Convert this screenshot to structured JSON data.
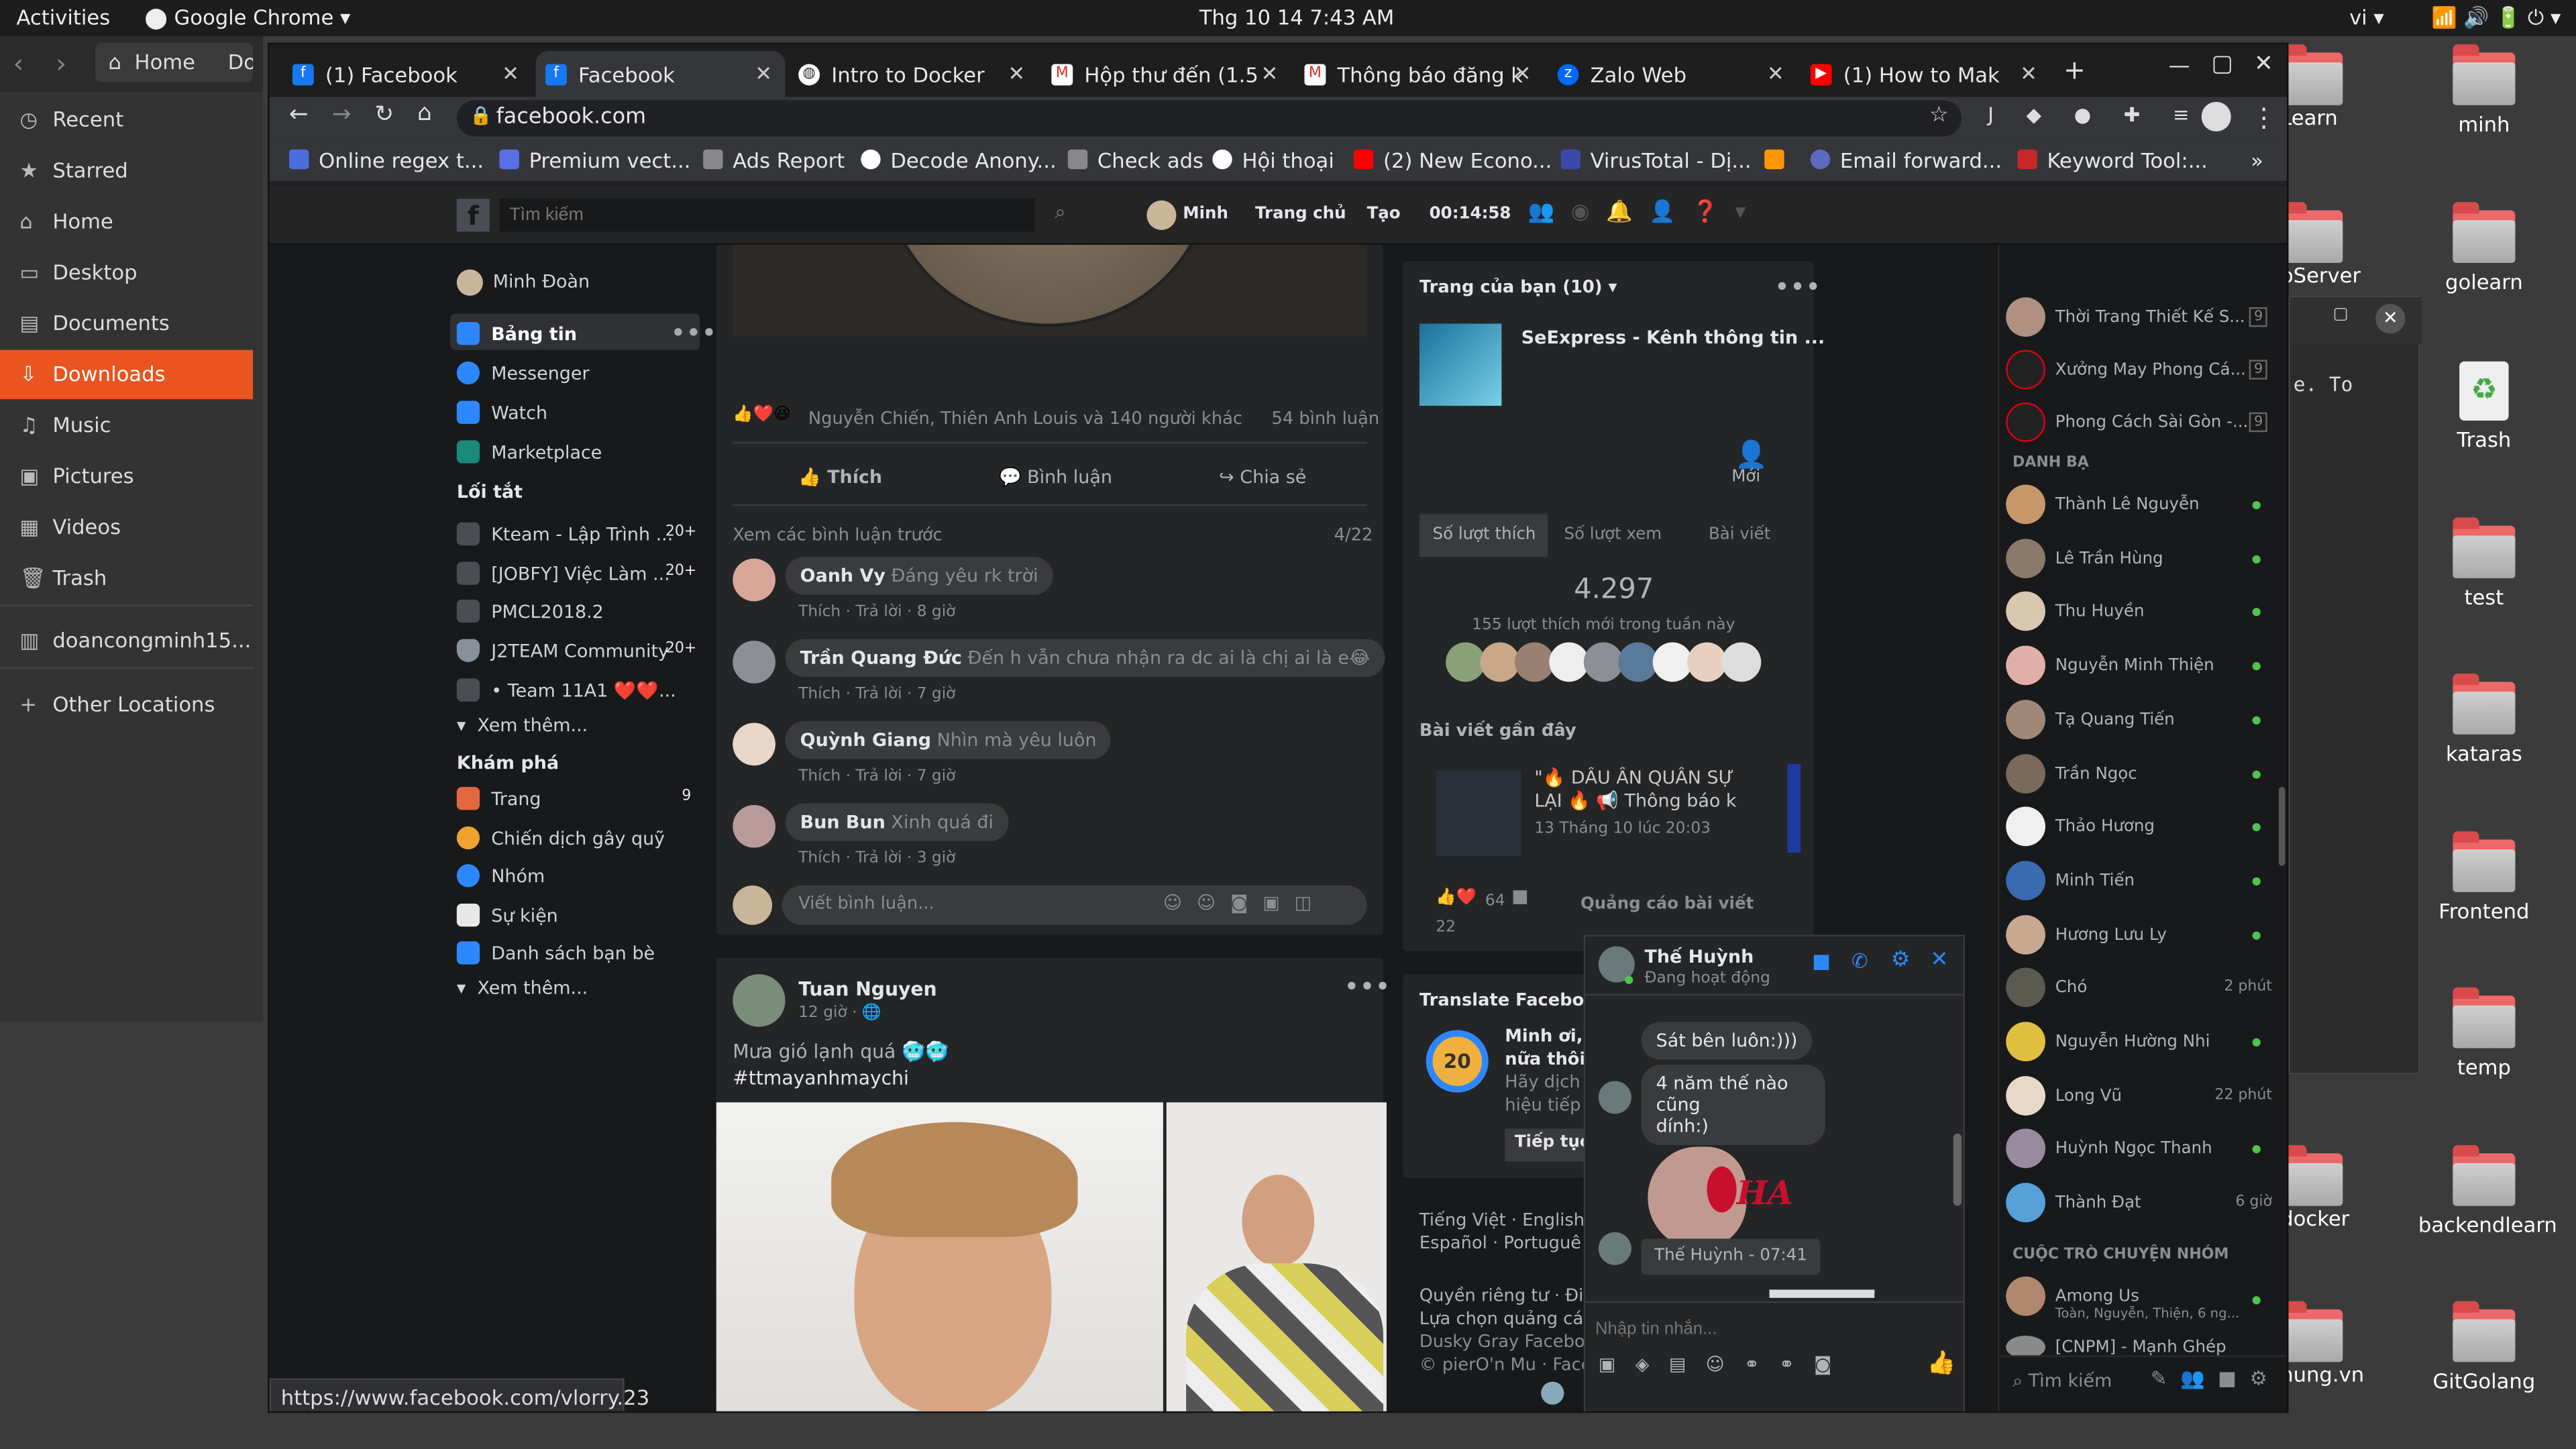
{
  "topbar": {
    "activities": "Activities",
    "app": "Google Chrome",
    "clock": "Thg 10 14   7:43 AM",
    "lang": "vi"
  },
  "desktop": {
    "icons": [
      "minh",
      "golearn",
      "Trash",
      "test",
      "kataras",
      "Frontend",
      "temp",
      "backendlearn",
      "GitGolang"
    ],
    "partial": [
      "Learn",
      "pServer",
      "docker",
      "hung.vn"
    ]
  },
  "files": {
    "home_label": "Home",
    "partial_tab": "Do",
    "sidebar": [
      "Recent",
      "Starred",
      "Home",
      "Desktop",
      "Documents",
      "Downloads",
      "Music",
      "Pictures",
      "Videos",
      "Trash",
      "doancongminh15...",
      "Other Locations"
    ]
  },
  "terminal_snippet": "e. To",
  "chrome": {
    "tabs": [
      "(1) Facebook",
      "Facebook",
      "Intro to Docker",
      "Hộp thư đến (1.5",
      "Thông báo đăng k",
      "Zalo Web",
      "(1) How to Mak"
    ],
    "url": "facebook.com",
    "bookmarks": [
      "Online regex t...",
      "Premium vect...",
      "Ads Report",
      "Decode Anony...",
      "Check ads",
      "Hội thoại",
      "(2) New Econo...",
      "VirusTotal - Dị...",
      "",
      "Email forward...",
      "Keyword Tool:..."
    ],
    "status_url": "https://www.facebook.com/vlorry.23"
  },
  "fb": {
    "search_placeholder": "Tìm kiếm",
    "header": {
      "user": "Minh",
      "home": "Trang chủ",
      "create": "Tạo",
      "timer": "00:14:58"
    },
    "left": {
      "user": "Minh Đoàn",
      "feed": "Bảng tin",
      "messenger": "Messenger",
      "watch": "Watch",
      "marketplace": "Marketplace",
      "shortcuts_title": "Lối tắt",
      "shortcuts": [
        {
          "label": "Kteam - Lập Trình ...",
          "badge": "20+"
        },
        {
          "label": "[JOBFY] Việc Làm ...",
          "badge": "20+"
        },
        {
          "label": "PMCL2018.2",
          "badge": ""
        },
        {
          "label": "J2TEAM Community",
          "badge": "20+"
        },
        {
          "label": "• Team 11A1 ❤️❤️...",
          "badge": ""
        }
      ],
      "see_more": "Xem thêm...",
      "explore_title": "Khám phá",
      "explore": [
        {
          "label": "Trang",
          "badge": "9"
        },
        {
          "label": "Chiến dịch gây quỹ",
          "badge": ""
        },
        {
          "label": "Nhóm",
          "badge": ""
        },
        {
          "label": "Sự kiện",
          "badge": ""
        },
        {
          "label": "Danh sách bạn bè",
          "badge": ""
        }
      ],
      "see_more2": "Xem thêm..."
    },
    "post1": {
      "reactions": "Nguyễn Chiến, Thiên Anh Louis và 140 người khác",
      "comments_count": "54 bình luận",
      "like": "Thích",
      "comment": "Bình luận",
      "share": "Chia sẻ",
      "prev_comments": "Xem các bình luận trước",
      "page": "4/22",
      "comments": [
        {
          "name": "Oanh Vy",
          "text": "Đáng yêu rk trời",
          "time": "8 giờ"
        },
        {
          "name": "Trần Quang Đức",
          "text": "Đến h vẫn chưa nhận ra dc ai là chị ai là e😂",
          "time": "7 giờ"
        },
        {
          "name": "Quỳnh Giang",
          "text": "Nhìn mà yêu luôn",
          "time": "7 giờ"
        },
        {
          "name": "Bun Bun",
          "text": "Xinh quá đi",
          "time": "3 giờ"
        }
      ],
      "meta_prefix": "Thích · Trả lời · ",
      "write_comment": "Viết bình luận..."
    },
    "post2": {
      "author": "Tuan Nguyen",
      "time": "12 giờ · 🌐",
      "text1": "Mưa gió lạnh quá 🥶🥶",
      "text2": "#ttmayanhmaychi"
    },
    "pages": {
      "title": "Trang của bạn (10) ▾",
      "page_name": "SeExpress - Kênh thông tin ...",
      "new_label": "Mới",
      "tabs": [
        "Số lượt thích",
        "Số lượt xem",
        "Bài viết"
      ],
      "likes": "4.297",
      "likes_sub": "155 lượt thích mới trong tuần này",
      "recent": "Bài viết gần đây",
      "recent_post": "\"🔥 DẤU ẤN QUÂN SỰ LẠI 🔥 📢 Thông báo k",
      "recent_date": "13 Tháng 10 lúc 20:03",
      "react_count": "64",
      "react_count2": "22",
      "promote": "Quảng cáo bài viết"
    },
    "translate": {
      "title": "Translate Facebook",
      "line1": "Minh ơi, l",
      "line2": "nữa thôi!",
      "line3": "Hãy dịch",
      "line4": "hiệu tiếp t",
      "button": "Tiếp tục",
      "badge": "20"
    },
    "footer": {
      "langs": "Tiếng Việt · English (",
      "langs2": "Español · Portuguê",
      "privacy": "Quyền riêng tư · Điều",
      "ads": "Lựa chọn quảng cáo",
      "dusky": "Dusky Gray Faceboo",
      "pier": "© pierO'n Mu · Faceb"
    },
    "chat": {
      "name": "Thế Huỳnh",
      "status": "Đang hoạt động",
      "messages": [
        "Sát bên luôn:)))",
        "4 năm thế nào cũng\ndính:)"
      ],
      "sticker_text": "HA",
      "stamp": "Thế Huỳnh - 07:41",
      "input_placeholder": "Nhập tin nhắn..."
    },
    "contacts": {
      "pages": [
        {
          "name": "Thời Trang Thiết Kế S...",
          "badge": "9"
        },
        {
          "name": "Xưởng May Phong Cá...",
          "badge": "9"
        },
        {
          "name": "Phong Cách Sài Gòn -...",
          "badge": "9"
        }
      ],
      "section": "DANH BẠ",
      "people": [
        {
          "name": "Thành Lê Nguyễn",
          "status": ""
        },
        {
          "name": "Lê Trần Hùng",
          "status": ""
        },
        {
          "name": "Thu Huyền",
          "status": ""
        },
        {
          "name": "Nguyễn Minh Thiện",
          "status": ""
        },
        {
          "name": "Tạ Quang Tiến",
          "status": ""
        },
        {
          "name": "Trần Ngọc",
          "status": ""
        },
        {
          "name": "Thảo Hương",
          "status": ""
        },
        {
          "name": "Minh Tiến",
          "status": ""
        },
        {
          "name": "Hương Lưu Ly",
          "status": ""
        },
        {
          "name": "Chó",
          "status": "2 phút"
        },
        {
          "name": "Nguyễn Hường Nhi",
          "status": ""
        },
        {
          "name": "Long Vũ",
          "status": "22 phút"
        },
        {
          "name": "Huỳnh Ngọc Thanh",
          "status": ""
        },
        {
          "name": "Thành Đạt",
          "status": "6 giờ"
        }
      ],
      "group_section": "CUỘC TRÒ CHUYỆN NHÓM",
      "group": {
        "name": "Among Us",
        "members": "Toàn, Nguyễn, Thiện, 6 ng..."
      },
      "group2": "[CNPM] - Mạnh Ghép",
      "search": "Tìm kiếm"
    }
  }
}
